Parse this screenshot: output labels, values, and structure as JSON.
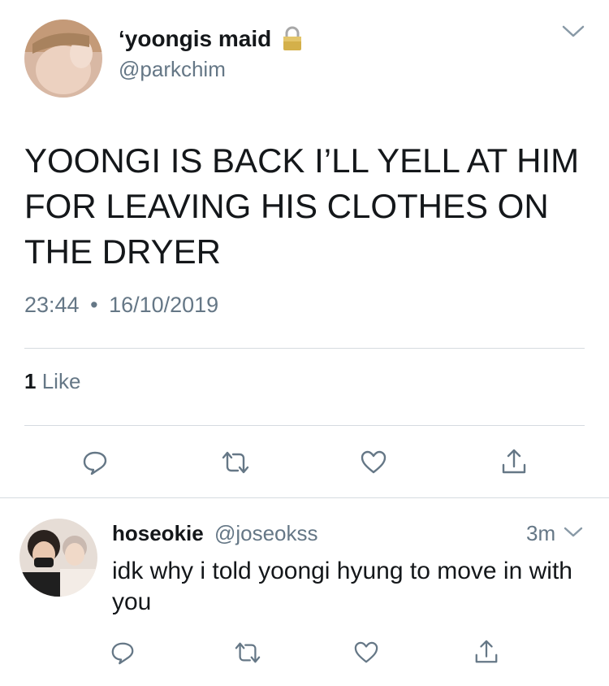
{
  "main_tweet": {
    "display_name": "‘yoongis maid",
    "handle": "@parkchim",
    "text": "YOONGI IS BACK I’LL YELL AT HIM FOR LEAVING HIS CLOTHES ON THE DRYER",
    "time": "23:44",
    "separator": "•",
    "date": "16/10/2019",
    "likes_count": "1",
    "likes_label": "Like",
    "icons": [
      "lock-icon",
      "chevron-down-icon",
      "reply-icon",
      "retweet-icon",
      "heart-icon",
      "share-icon"
    ]
  },
  "reply_tweet": {
    "display_name": "hoseokie",
    "handle": "@joseokss",
    "age": "3m",
    "text": "idk why i told yoongi hyung to move in with you",
    "icons": [
      "chevron-down-icon",
      "reply-icon",
      "retweet-icon",
      "heart-icon",
      "share-icon"
    ]
  },
  "colors": {
    "text": "#14171a",
    "muted": "#657786",
    "divider": "#d6dbe0",
    "lock": "#c9a227"
  }
}
